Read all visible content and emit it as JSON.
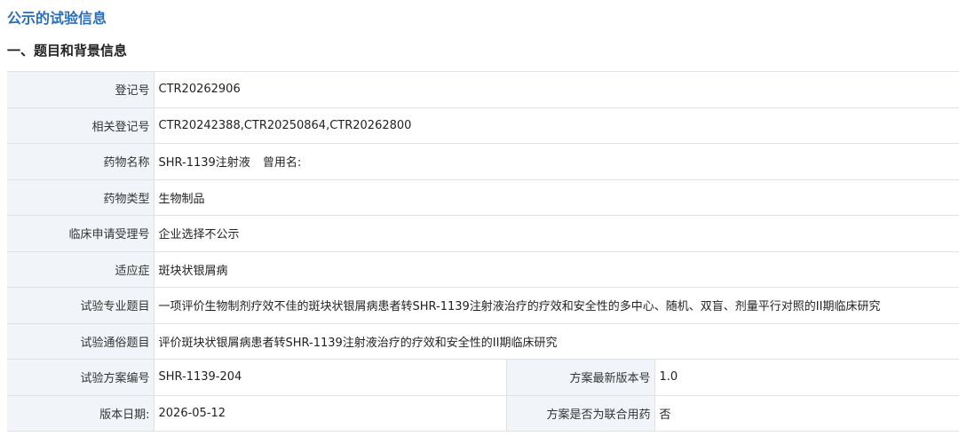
{
  "page_title": "公示的试验信息",
  "section_heading": "一、题目和背景信息",
  "rows": {
    "registration_no": {
      "label": "登记号",
      "value": "CTR20262906"
    },
    "related_registration_no": {
      "label": "相关登记号",
      "value": "CTR20242388,CTR20250864,CTR20262800"
    },
    "drug_name": {
      "label": "药物名称",
      "value": "SHR-1139注射液",
      "alias_label": "曾用名:",
      "alias_value": ""
    },
    "drug_type": {
      "label": "药物类型",
      "value": "生物制品"
    },
    "clinical_application_no": {
      "label": "临床申请受理号",
      "value": "企业选择不公示"
    },
    "indication": {
      "label": "适应症",
      "value": "斑块状银屑病"
    },
    "scientific_title": {
      "label": "试验专业题目",
      "value": "一项评价生物制剂疗效不佳的斑块状银屑病患者转SHR-1139注射液治疗的疗效和安全性的多中心、随机、双盲、剂量平行对照的II期临床研究"
    },
    "public_title": {
      "label": "试验通俗题目",
      "value": "评价斑块状银屑病患者转SHR-1139注射液治疗的疗效和安全性的II期临床研究"
    },
    "protocol_no": {
      "label": "试验方案编号",
      "value": "SHR-1139-204"
    },
    "protocol_version": {
      "label": "方案最新版本号",
      "value": "1.0"
    },
    "version_date": {
      "label": "版本日期:",
      "value": "2026-05-12"
    },
    "combination": {
      "label": "方案是否为联合用药",
      "value": "否"
    }
  }
}
